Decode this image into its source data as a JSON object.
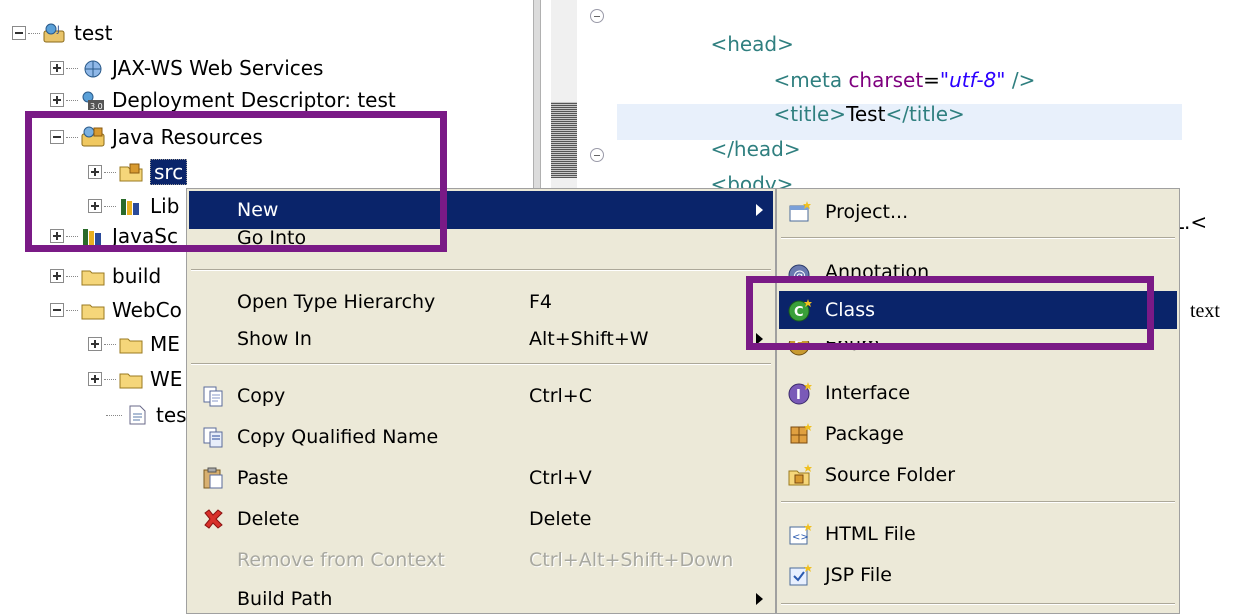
{
  "tree": {
    "items": [
      {
        "label": "test",
        "icon": "web-project-icon"
      },
      {
        "label": "JAX-WS Web Services",
        "icon": "web-services-icon"
      },
      {
        "label": "Deployment Descriptor: test",
        "icon": "deployment-descriptor-icon"
      },
      {
        "label": "Java Resources",
        "icon": "java-resources-icon"
      },
      {
        "label": "src",
        "icon": "source-folder-icon"
      },
      {
        "label": "Lib",
        "icon": "libraries-icon"
      },
      {
        "label": "JavaSc",
        "icon": "javascript-resources-icon"
      },
      {
        "label": "build",
        "icon": "folder-icon"
      },
      {
        "label": "WebCo",
        "icon": "folder-icon"
      },
      {
        "label": "ME",
        "icon": "folder-icon"
      },
      {
        "label": "WE",
        "icon": "folder-icon"
      },
      {
        "label": "tes",
        "icon": "file-icon"
      }
    ]
  },
  "editor": {
    "lines": [
      {
        "tag_open": "<head>"
      },
      {
        "tag_open": "<meta ",
        "attr": "charset",
        "eq": "=",
        "str": "\"utf-8\"",
        "tag_close": " />"
      },
      {
        "tag_open": "<title>",
        "text": "Test",
        "tag_close": "</title>"
      },
      {
        "tag_open": "</head>"
      },
      {
        "tag_open": "<body>"
      },
      {
        "tag_open": "TML.<"
      }
    ]
  },
  "context_menu": {
    "items": [
      {
        "label": "New",
        "shortcut": "",
        "submenu": true,
        "highlighted": true
      },
      {
        "label": "Go Into",
        "shortcut": ""
      },
      {
        "label": "Open Type Hierarchy",
        "shortcut": "F4"
      },
      {
        "label": "Show In",
        "shortcut": "Alt+Shift+W",
        "submenu": true
      },
      {
        "label": "Copy",
        "shortcut": "Ctrl+C",
        "icon": "copy-icon"
      },
      {
        "label": "Copy Qualified Name",
        "shortcut": "",
        "icon": "copy-qualified-name-icon"
      },
      {
        "label": "Paste",
        "shortcut": "Ctrl+V",
        "icon": "paste-icon"
      },
      {
        "label": "Delete",
        "shortcut": "Delete",
        "icon": "delete-icon"
      },
      {
        "label": "Remove from Context",
        "shortcut": "Ctrl+Alt+Shift+Down",
        "disabled": true
      },
      {
        "label": "Build Path",
        "shortcut": "",
        "submenu": true
      }
    ]
  },
  "submenu": {
    "items": [
      {
        "label": "Project...",
        "icon": "new-project-icon"
      },
      {
        "label": "Annotation",
        "icon": "annotation-icon"
      },
      {
        "label": "Class",
        "icon": "class-icon",
        "highlighted": true
      },
      {
        "label": "Enum",
        "icon": "enum-icon"
      },
      {
        "label": "Interface",
        "icon": "interface-icon"
      },
      {
        "label": "Package",
        "icon": "package-icon"
      },
      {
        "label": "Source Folder",
        "icon": "source-folder-new-icon"
      },
      {
        "label": "HTML File",
        "icon": "html-file-icon"
      },
      {
        "label": "JSP File",
        "icon": "jsp-file-icon"
      }
    ]
  },
  "annotation_text": "text",
  "colors": {
    "highlight": "#0a246a",
    "annotation_box": "#7a1a86",
    "menu_bg": "#ece9d8",
    "tag": "#2f7f7f",
    "attr": "#7f007f",
    "string": "#2a00ff"
  }
}
